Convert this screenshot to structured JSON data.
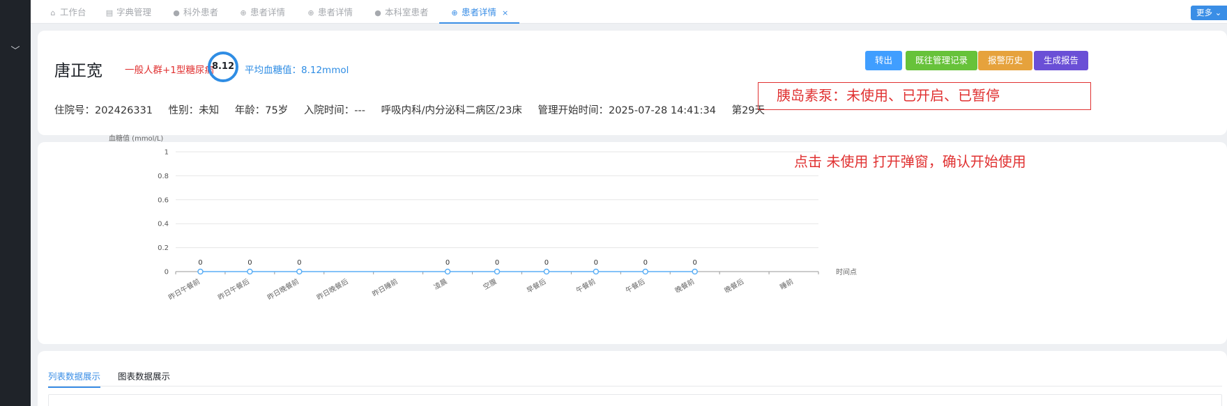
{
  "sidebar": {
    "toggle_icon": "chevron-down-icon",
    "toggle_glyph": "﹀"
  },
  "tabs": [
    {
      "label": "工作台",
      "icon": "home-icon",
      "glyph": "⌂"
    },
    {
      "label": "字典管理",
      "icon": "document-icon",
      "glyph": "▤"
    },
    {
      "label": "科外患者",
      "icon": "user-icon",
      "glyph": "●"
    },
    {
      "label": "患者详情",
      "icon": "target-icon",
      "glyph": "⊕"
    },
    {
      "label": "患者详情",
      "icon": "target-icon",
      "glyph": "⊕"
    },
    {
      "label": "本科室患者",
      "icon": "user-icon",
      "glyph": "●"
    },
    {
      "label": "患者详情",
      "icon": "target-icon",
      "glyph": "⊕",
      "active": true,
      "close": "×"
    }
  ],
  "more_label": "更多",
  "patient": {
    "name": "唐正宽",
    "tag": "一般人群+1型糖尿病",
    "glucose_ring": "8.12",
    "avg_glucose": "平均血糖值：8.12mmol",
    "admission_no": "住院号：202426331",
    "gender": "性别：未知",
    "age": "年龄：75岁",
    "admit_time": "入院时间：---",
    "ward": "呼吸内科/内分泌科二病区/23床",
    "mgmt_start": "管理开始时间：2025-07-28 14:41:34",
    "day": "第29天"
  },
  "buttons": {
    "transfer": "转出",
    "history": "既往管理记录",
    "alarm": "报警历史",
    "report": "生成报告"
  },
  "colors": {
    "accent": "#3a8ee6",
    "btn_transfer": "#409eff",
    "btn_history": "#67c23a",
    "btn_alarm": "#e6a23c",
    "btn_report": "#6a4fd6",
    "annotation": "#e03131",
    "line": "#5aaef5"
  },
  "annotation": {
    "pump_status": "胰岛素泵：未使用、已开启、已暂停",
    "pump_tip": "点击 未使用 打开弹窗，确认开始使用"
  },
  "chart_data": {
    "type": "line",
    "ylabel": "血糖值 (mmol/L)",
    "xlabel": "时间点",
    "ylim": [
      0,
      1
    ],
    "yticks": [
      0,
      0.2,
      0.4,
      0.6,
      0.8,
      1
    ],
    "categories": [
      "昨日午餐前",
      "昨日午餐后",
      "昨日晚餐前",
      "昨日晚餐后",
      "昨日睡前",
      "凌晨",
      "空腹",
      "早餐后",
      "午餐前",
      "午餐后",
      "晚餐前",
      "晚餐后",
      "睡前"
    ],
    "values": [
      0,
      0,
      0,
      null,
      null,
      0,
      0,
      0,
      0,
      0,
      0,
      null,
      null
    ],
    "grid": true
  },
  "data_tabs": [
    "列表数据展示",
    "图表数据展示"
  ]
}
